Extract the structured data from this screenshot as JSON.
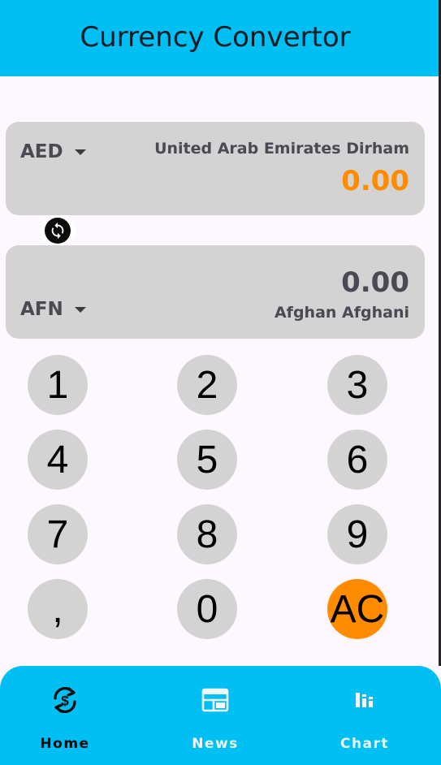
{
  "header": {
    "title": "Currency Convertor"
  },
  "from": {
    "code": "AED",
    "name": "United Arab Emirates Dirham",
    "value": "0.00"
  },
  "to": {
    "code": "AFN",
    "name": "Afghan Afghani",
    "value": "0.00"
  },
  "keypad": {
    "keys": [
      "1",
      "2",
      "3",
      "4",
      "5",
      "6",
      "7",
      "8",
      "9",
      ",",
      "0",
      "AC"
    ]
  },
  "nav": {
    "items": [
      {
        "label": "Home",
        "icon": "currency-exchange-icon",
        "active": true
      },
      {
        "label": "News",
        "icon": "newspaper-icon",
        "active": false
      },
      {
        "label": "Chart",
        "icon": "bar-chart-icon",
        "active": false
      }
    ]
  },
  "colors": {
    "primary": "#00bff3",
    "accent": "#ff8c00",
    "card": "#d3d3d3",
    "background": "#fdf7ff",
    "text_dark": "#4a4a52"
  }
}
